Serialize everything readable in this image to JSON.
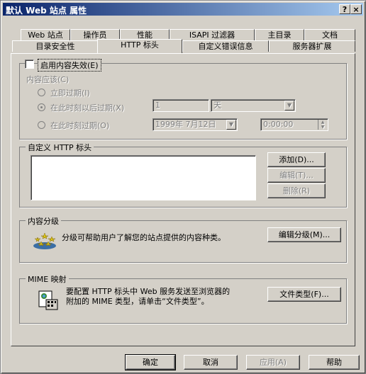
{
  "window": {
    "title": "默认 Web 站点 属性",
    "help_btn": "?",
    "close_btn": "×"
  },
  "tabs": {
    "row1": [
      "Web 站点",
      "操作员",
      "性能",
      "ISAPI 过滤器",
      "主目录",
      "文档"
    ],
    "row2": [
      "目录安全性",
      "HTTP 标头",
      "自定义错误信息",
      "服务器扩展"
    ],
    "active": "HTTP 标头"
  },
  "expiration": {
    "checkbox_label": "启用内容失效(E)",
    "content_label": "内容应该(C)",
    "radio_immediately": "立即过期(I)",
    "radio_after": "在此时刻以后过期(X)",
    "radio_on": "在此时刻过期(O)",
    "after_value": "1",
    "after_unit": "天",
    "date_value": "1999年 7月12日",
    "time_value": "0:00:00"
  },
  "custom_headers": {
    "legend": "自定义 HTTP 标头",
    "add_btn": "添加(D)...",
    "edit_btn": "编辑(T)...",
    "remove_btn": "删除(R)"
  },
  "rating": {
    "legend": "内容分级",
    "text": "分级可帮助用户了解您的站点提供的内容种类。",
    "edit_btn": "编辑分级(M)..."
  },
  "mime": {
    "legend": "MIME 映射",
    "text_line1": "要配置 HTTP 标头中 Web 服务发送至浏览器的",
    "text_line2": "附加的 MIME 类型，请单击“文件类型”。",
    "types_btn": "文件类型(F)..."
  },
  "footer": {
    "ok": "确定",
    "cancel": "取消",
    "apply": "应用(A)",
    "help": "帮助"
  }
}
